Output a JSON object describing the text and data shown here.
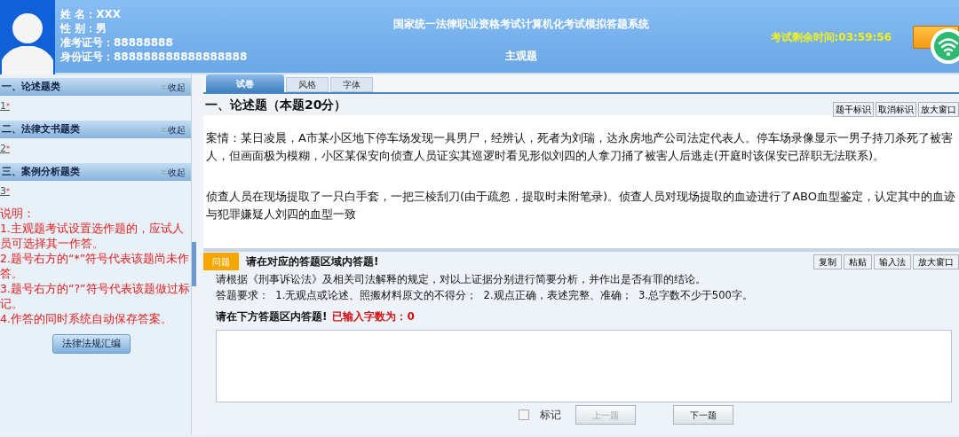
{
  "candidate": {
    "name_label": "姓 名：XXX",
    "gender_label": "性 别：男",
    "exam_no_label": "准考证号：88888888",
    "id_label": "身份证号：888888888888888888"
  },
  "header": {
    "title": "国家统一法律职业资格考试计算机化考试模拟答题系统",
    "subtitle": "主观题",
    "timer": "考试剩余时间:03:59:56"
  },
  "sidebar": {
    "sections": [
      {
        "title": "一、论述题类",
        "collapse": "收起",
        "items": [
          {
            "number": "1",
            "mark": "*"
          }
        ]
      },
      {
        "title": "二、法律文书题类",
        "collapse": "收起",
        "items": [
          {
            "number": "2",
            "mark": "*"
          }
        ]
      },
      {
        "title": "三、案例分析题类",
        "collapse": "收起",
        "items": [
          {
            "number": "3",
            "mark": "*"
          }
        ]
      }
    ],
    "notes": [
      "说明：",
      "1.主观题考试设置选作题的，应试人员可选择其一作答。",
      "2.题号右方的“*”符号代表该题尚未作答。",
      "3.题号右方的“?”符号代表该题做过标记。",
      "4.作答的同时系统自动保存答案。"
    ],
    "law_button": "法律法规汇编"
  },
  "tabs": [
    {
      "label": "试卷",
      "selected": true
    },
    {
      "label": "风格",
      "selected": false
    },
    {
      "label": "字体",
      "selected": false
    }
  ],
  "question": {
    "heading": "一、论述题（本题20分）",
    "tools": [
      "题干标识",
      "取消标识",
      "放大窗口"
    ],
    "paragraphs": [
      "案情：某日凌晨，A市某小区地下停车场发现一具男尸，经辨认，死者为刘瑞，达永房地产公司法定代表人。停车场录像显示一男子持刀杀死了被害人，但画面极为模糊，小区某保安向侦查人员证实其巡逻时看见形似刘四的人拿刀捅了被害人后逃走(开庭时该保安已辞职无法联系)。",
      "侦查人员在现场提取了一只白手套，一把三棱刮刀(由于疏忽，提取时未附笔录)。侦查人员对现场提取的血迹进行了ABO血型鉴定，认定其中的血迹与犯罪嫌疑人刘四的血型一致"
    ]
  },
  "answer": {
    "badge": "问题",
    "heading": "请在对应的答题区域内答题!",
    "tools": [
      "复制",
      "粘贴",
      "输入法",
      "放大窗口"
    ],
    "prompt": "请根据《刑事诉讼法》及相关司法解释的规定，对以上证据分别进行简要分析，并作出是否有罪的结论。",
    "requirements": "答题要求：  1.无观点或论述、照搬材料原文的不得分；  2.观点正确，表述完整、准确；  3.总字数不少于500字。",
    "area_label": "请在下方答题区内答题!",
    "count": "已输入字数为：0"
  },
  "footer": {
    "mark_label": "标记",
    "marked": false,
    "prev": {
      "label": "上一题",
      "disabled": true
    },
    "next": {
      "label": "下一题",
      "disabled": false
    }
  }
}
